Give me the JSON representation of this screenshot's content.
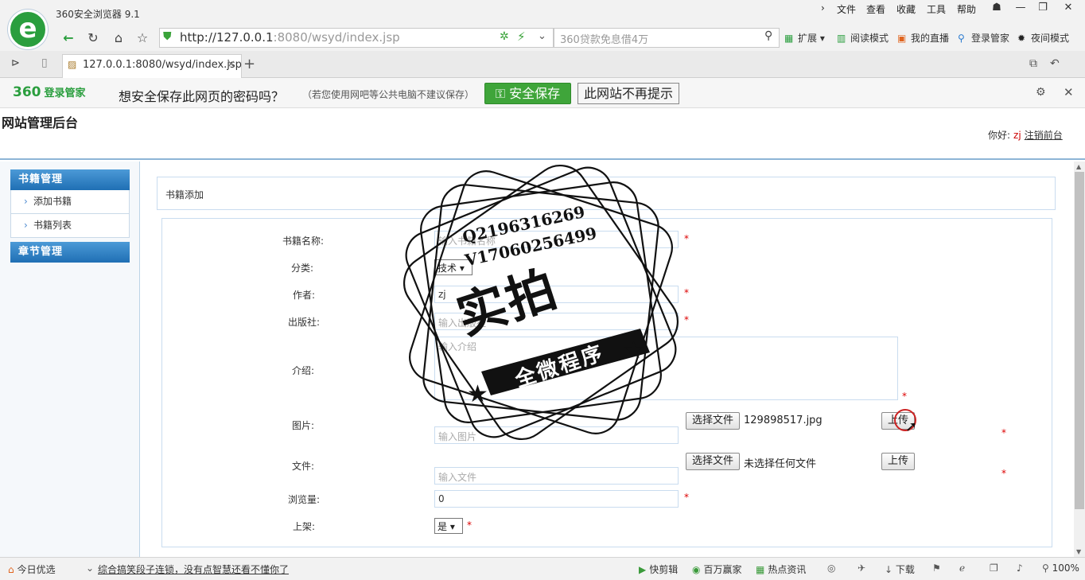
{
  "browser": {
    "app_title": "360安全浏览器 9.1",
    "menu": [
      "文件",
      "查看",
      "收藏",
      "工具",
      "帮助"
    ],
    "url_host": "http://127.0.0.1",
    "url_rest": ":8080/wsyd/index.jsp",
    "search_placeholder": "360贷款免息借4万",
    "toolbar": [
      "扩展",
      "阅读模式",
      "我的直播",
      "登录管家",
      "夜间模式"
    ],
    "tab_title": "127.0.0.1:8080/wsyd/index.jsp",
    "logo_letter": "e"
  },
  "password_bar": {
    "brand": "360",
    "brand_sub": "登录管家",
    "question": "想安全保存此网页的密码吗？",
    "note": "（若您使用网吧等公共电脑不建议保存）",
    "save_label": "安全保存",
    "never_label": "此网站不再提示"
  },
  "site": {
    "title": "网站管理后台",
    "greeting": "你好:",
    "user": "zj",
    "logout": "注销",
    "front": "前台"
  },
  "sidebar": {
    "book_mgmt": "书籍管理",
    "items": [
      "添加书籍",
      "书籍列表"
    ],
    "chapter_mgmt": "章节管理"
  },
  "form": {
    "panel_title": "书籍添加",
    "name_label": "书籍名称:",
    "name_placeholder": "输入书籍名称",
    "category_label": "分类:",
    "category_value": "技术",
    "author_label": "作者:",
    "author_value": "zj",
    "publisher_label": "出版社:",
    "publisher_placeholder": "输入出版社",
    "intro_label": "介绍:",
    "intro_placeholder": "输入介绍",
    "image_label": "图片:",
    "image_placeholder": "输入图片",
    "file_label": "文件:",
    "file_placeholder": "输入文件",
    "choose_file": "选择文件",
    "image_file_name": "129898517.jpg",
    "no_file": "未选择任何文件",
    "upload": "上传",
    "views_label": "浏览量:",
    "views_value": "0",
    "shelf_label": "上架:",
    "shelf_value": "是",
    "required_mark": "*"
  },
  "stamp": {
    "q": "Q2196316269",
    "v": "V17060256499",
    "title": "实拍",
    "sub": "全微程序"
  },
  "statusbar": {
    "today": "今日优选",
    "news": "综合搞笑段子连锁，没有点智慧还看不懂你了",
    "items": [
      "快剪辑",
      "百万赢家",
      "热点资讯"
    ],
    "download": "下载",
    "zoom": "100%"
  }
}
